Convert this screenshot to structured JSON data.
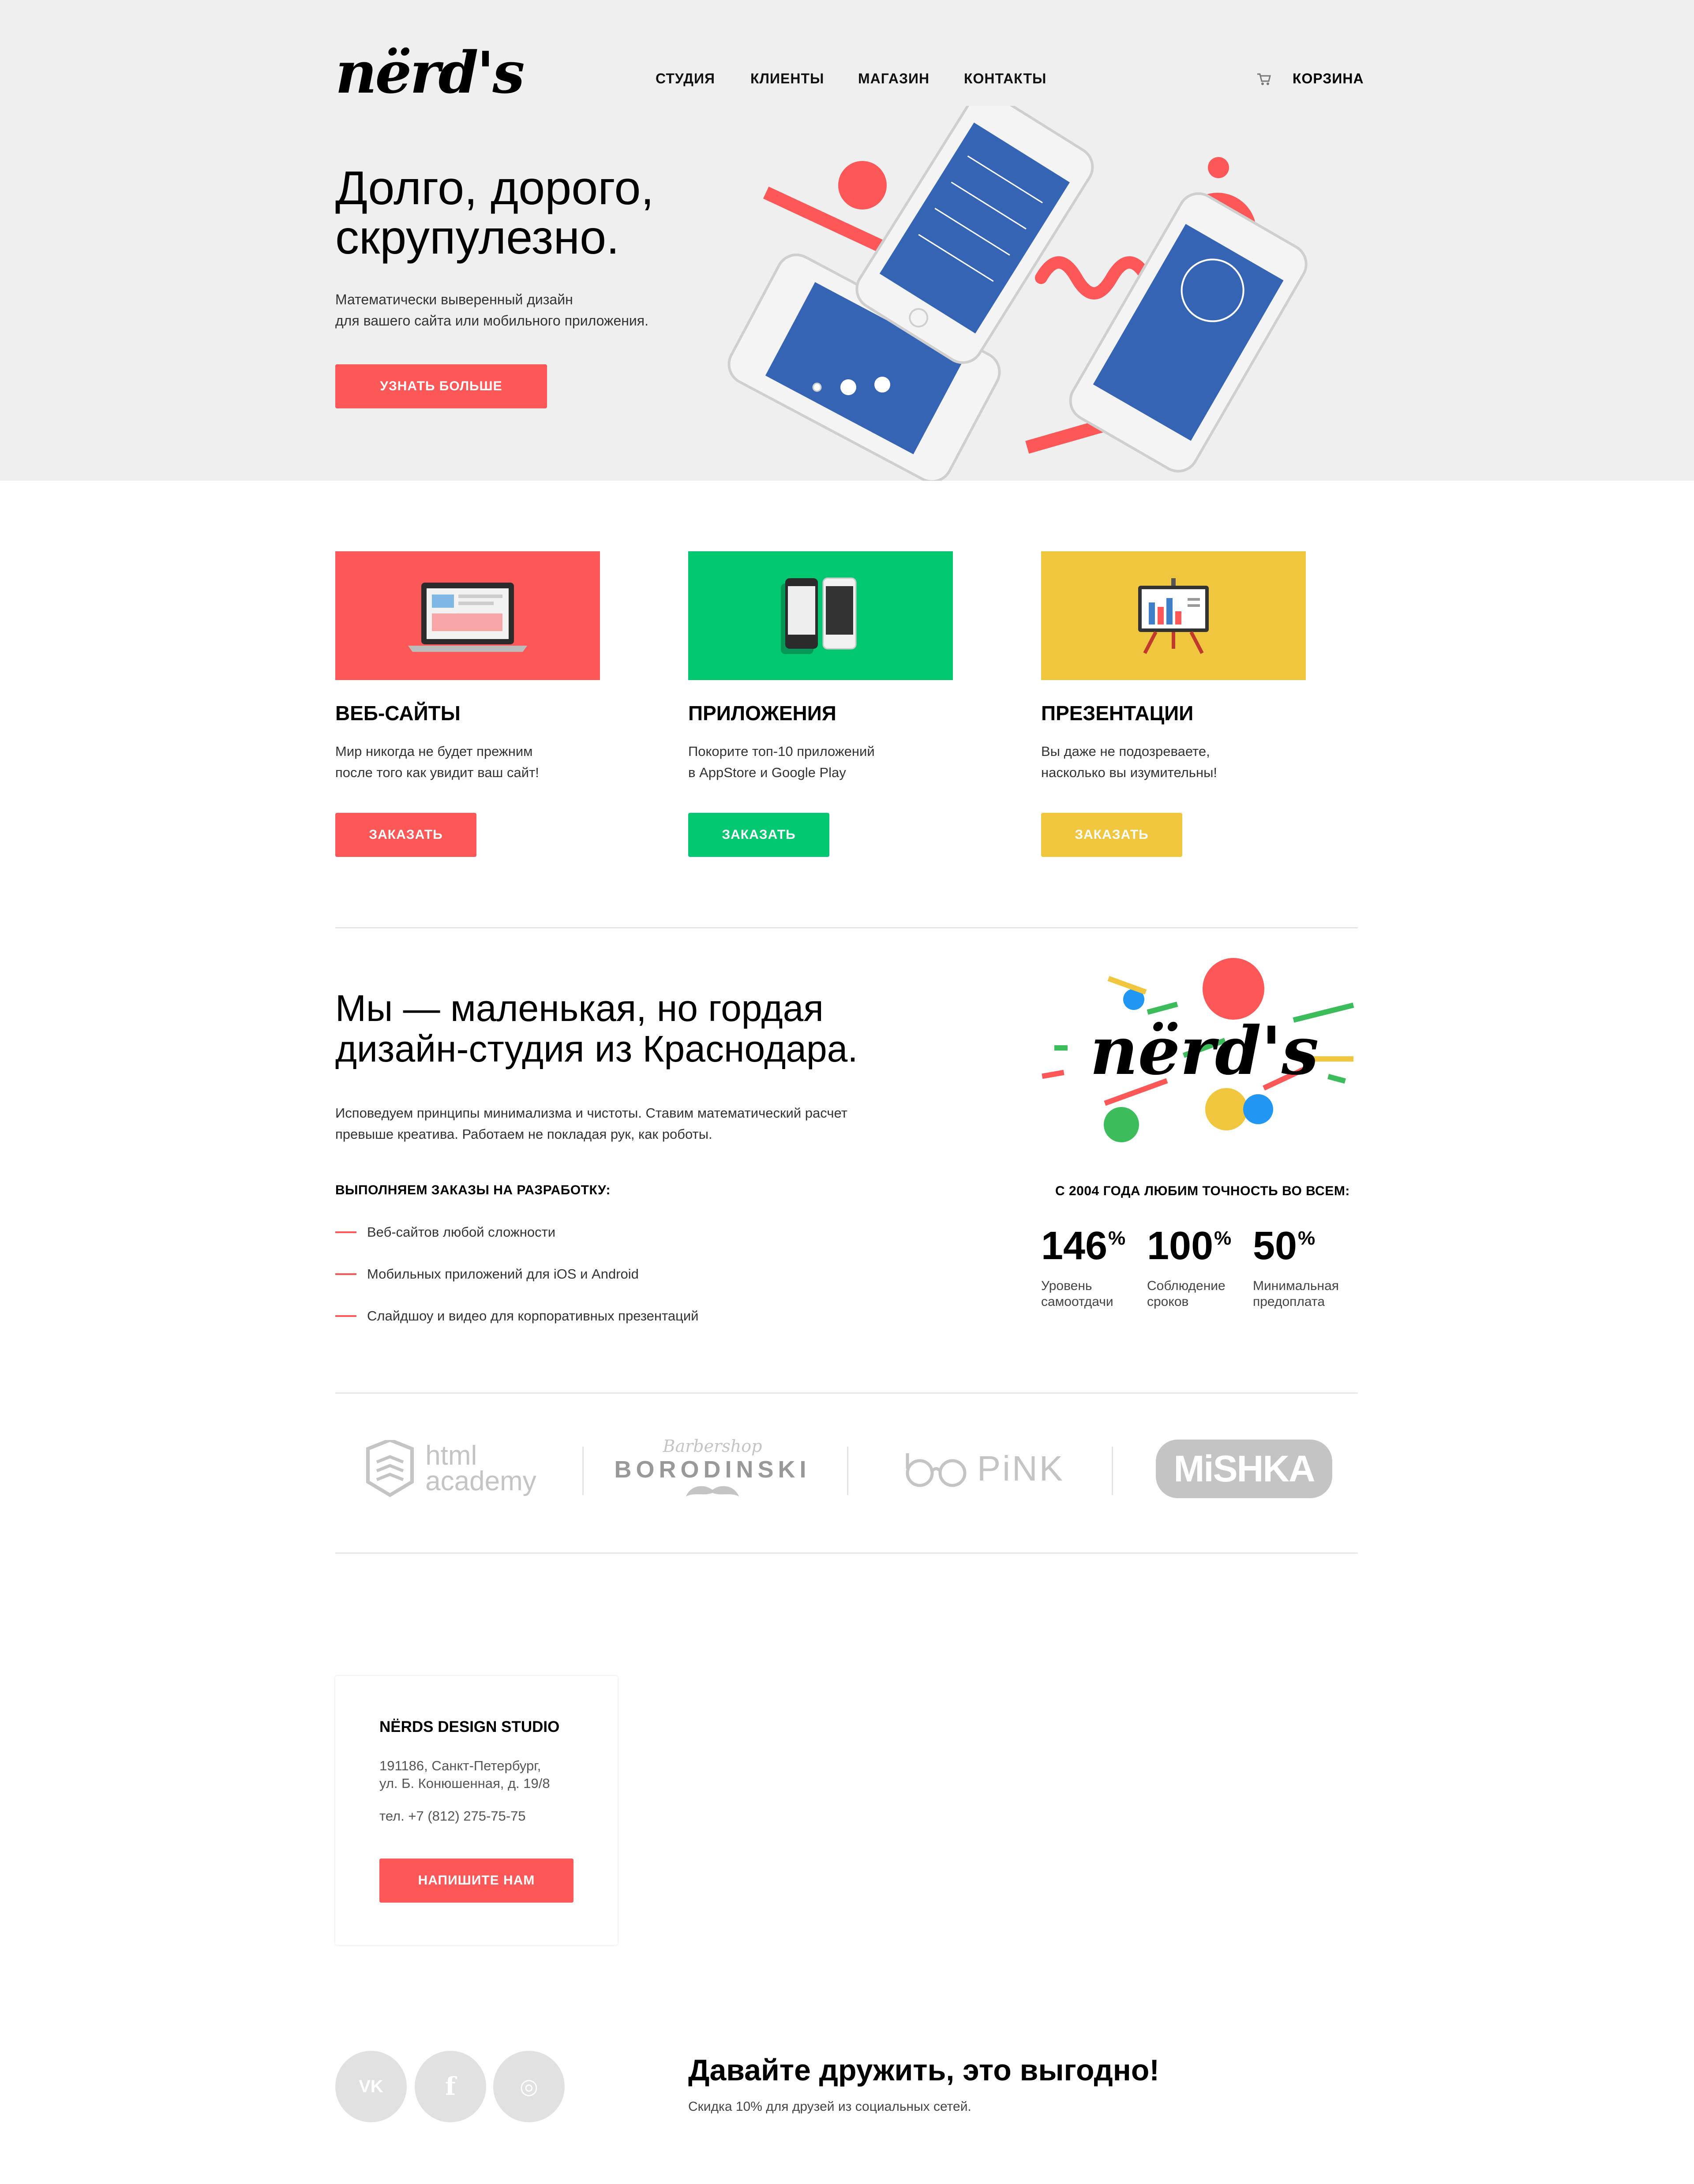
{
  "header": {
    "logo": "nërd's",
    "nav": [
      "СТУДИЯ",
      "КЛИЕНТЫ",
      "МАГАЗИН",
      "КОНТАКТЫ"
    ],
    "cart_label": "КОРЗИНА"
  },
  "hero": {
    "title_line1": "Долго, дорого,",
    "title_line2": "скрупулезно.",
    "subtitle_line1": "Математически выверенный дизайн",
    "subtitle_line2": "для вашего сайта или мобильного приложения.",
    "cta": "УЗНАТЬ БОЛЬШЕ"
  },
  "services": [
    {
      "title": "ВЕБ-САЙТЫ",
      "desc1": "Мир никогда не будет прежним",
      "desc2": "после того как увидит ваш сайт!",
      "button": "ЗАКАЗАТЬ",
      "color": "#fe5758"
    },
    {
      "title": "ПРИЛОЖЕНИЯ",
      "desc1": "Покорите топ-10 приложений",
      "desc2": "в AppStore и Google Play",
      "button": "ЗАКАЗАТЬ",
      "color": "#00c770"
    },
    {
      "title": "ПРЕЗЕНТАЦИИ",
      "desc1": "Вы даже не подозреваете,",
      "desc2": "насколько вы изумительны!",
      "button": "ЗАКАЗАТЬ",
      "color": "#f0c63f"
    }
  ],
  "about": {
    "title_line1": "Мы — маленькая, но гордая",
    "title_line2": "дизайн-студия из Краснодара.",
    "text_line1": "Исповедуем принципы минимализма и чистоты. Ставим математический расчет",
    "text_line2": "превыше креатива. Работаем не покладая рук, как роботы.",
    "list_title": "ВЫПОЛНЯЕМ ЗАКАЗЫ НА РАЗРАБОТКУ:",
    "list": [
      "Веб-сайтов любой сложности",
      "Мобильных приложений для iOS и Android",
      "Слайдшоу и видео для корпоративных презентаций"
    ],
    "stats_title": "С 2004 ГОДА ЛЮБИМ ТОЧНОСТЬ ВО ВСЕМ:",
    "stats": [
      {
        "value": "146",
        "unit": "%",
        "label1": "Уровень",
        "label2": "самоотдачи"
      },
      {
        "value": "100",
        "unit": "%",
        "label1": "Соблюдение",
        "label2": "сроков"
      },
      {
        "value": "50",
        "unit": "%",
        "label1": "Минимальная",
        "label2": "предоплата"
      }
    ]
  },
  "partners": {
    "html_academy_1": "html",
    "html_academy_2": "academy",
    "borodinski_top": "Barbershop",
    "borodinski": "BORODINSKI",
    "pink": "PiNK",
    "mishka": "MiSHKA"
  },
  "contacts": {
    "title": "NËRDS DESIGN STUDIO",
    "address1": "191186, Санкт-Петербург,",
    "address2": "ул. Б. Конюшенная, д. 19/8",
    "phone": "тел. +7 (812) 275-75-75",
    "button": "НАПИШИТЕ НАМ"
  },
  "footer": {
    "social": [
      "VK",
      "f",
      "◎"
    ],
    "title": "Давайте дружить, это выгодно!",
    "subtitle": "Скидка 10% для друзей из социальных сетей."
  },
  "colors": {
    "accent": "#fe5758",
    "green": "#00c770",
    "yellow": "#f0c63f",
    "hero_bg": "#efefef"
  }
}
